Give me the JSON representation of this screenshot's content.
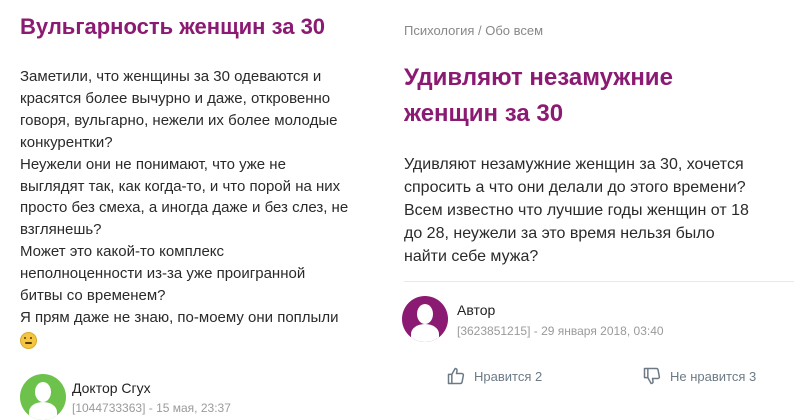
{
  "left": {
    "title": "Вульгарность женщин за 30",
    "paragraphs": [
      "Заметили, что женщины за 30 одеваются и",
      "красятся более вычурно и даже, откровенно",
      "говоря, вульгарно, нежели их более молодые",
      "конкурентки?",
      "Неужели они не понимают, что уже не",
      "выглядят так, как когда-то, и что порой на них",
      "просто без смеха, а иногда даже и без слез, не",
      "взглянешь?",
      "Может это какой-то комплекс",
      "неполноценности из-за уже проигранной",
      "битвы со временем?",
      "Я прям даже не знаю, по-моему они поплыли"
    ],
    "author": {
      "name": "Доктор Сгух",
      "meta": "[1044733363] - 15 мая, 23:37"
    }
  },
  "right": {
    "breadcrumb": "Психология / Обо всем",
    "title_lines": [
      "Удивляют незамужние",
      "женщин за 30"
    ],
    "body_lines": [
      "Удивляют незамужние женщин за 30, хочется",
      "спросить а что они делали до этого времени?",
      "Всем известно что лучшие годы женщин от 18",
      "до 28, неужели за это время нельзя было",
      "найти себе мужа?"
    ],
    "author": {
      "name": "Автор",
      "meta": "[3623851215] - 29 января 2018, 03:40"
    },
    "like_label": "Нравится 2",
    "dislike_label": "Не нравится 3"
  },
  "colors": {
    "accent": "#8b1a72",
    "avatar_left": "#6cc24a",
    "avatar_right": "#8b1a72",
    "muted": "#9a9a9a",
    "reaction": "#6c7a86"
  },
  "icons": {
    "emoji": "smiling-face-icon",
    "avatar": "user-silhouette-icon",
    "like": "thumbs-up-icon",
    "dislike": "thumbs-down-icon"
  }
}
